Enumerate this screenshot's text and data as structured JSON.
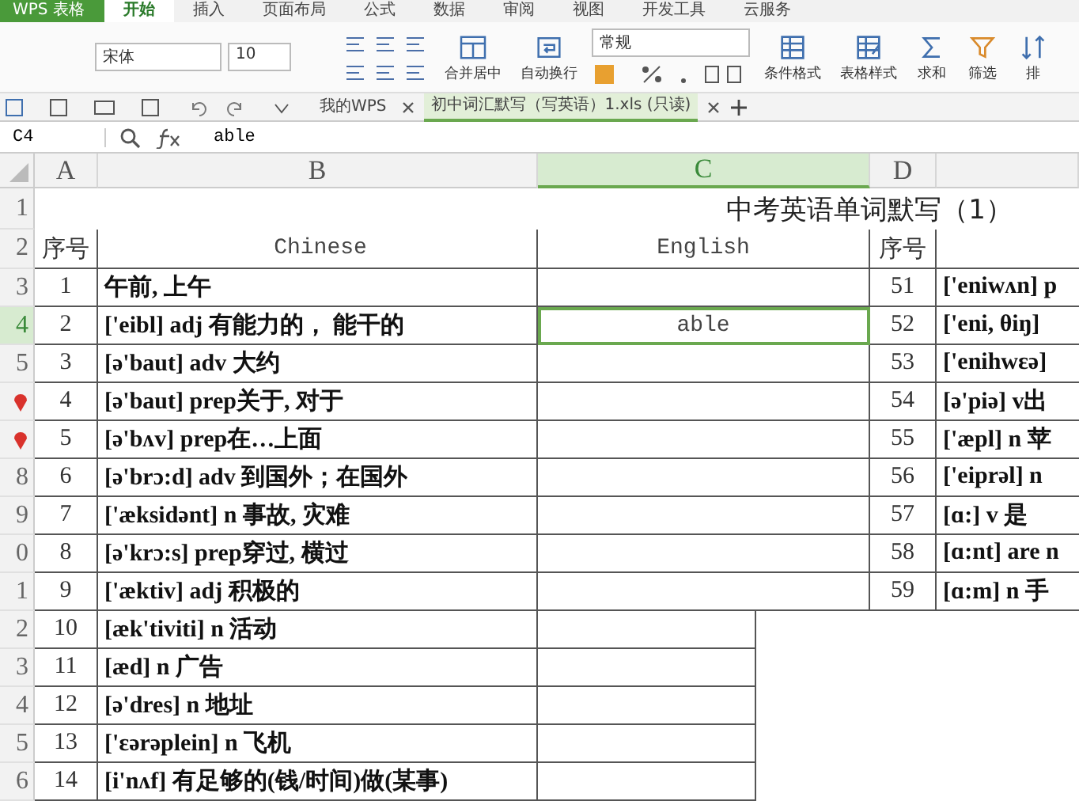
{
  "app": {
    "label": "WPS 表格"
  },
  "menu_tabs": [
    {
      "label": "开始",
      "selected": true
    },
    {
      "label": "插入",
      "selected": false
    },
    {
      "label": "页面布局",
      "selected": false
    },
    {
      "label": "公式",
      "selected": false
    },
    {
      "label": "数据",
      "selected": false
    },
    {
      "label": "审阅",
      "selected": false
    },
    {
      "label": "视图",
      "selected": false
    },
    {
      "label": "开发工具",
      "selected": false
    },
    {
      "label": "云服务",
      "selected": false
    }
  ],
  "ribbon": {
    "font": "宋体",
    "font_size": "10",
    "number_format": "常规",
    "buttons": [
      {
        "kind": "merge",
        "label": "合并居中"
      },
      {
        "kind": "wrap",
        "label": "自动换行"
      }
    ],
    "right_buttons": [
      {
        "kind": "conditional",
        "label": "条件格式"
      },
      {
        "kind": "table",
        "label": "表格样式"
      },
      {
        "kind": "sum",
        "label": "求和"
      },
      {
        "kind": "filter",
        "label": "筛选"
      },
      {
        "kind": "sort",
        "label": "排"
      }
    ]
  },
  "doc_tabs": [
    {
      "label": "我的WPS",
      "selected": false
    },
    {
      "label": "初中词汇默写（写英语）1.xls (只读)",
      "selected": true
    }
  ],
  "formula_bar": {
    "name_box": "C4",
    "formula": "able"
  },
  "columns": [
    {
      "label": "A",
      "selected": false
    },
    {
      "label": "B",
      "selected": false
    },
    {
      "label": "C",
      "selected": true
    },
    {
      "label": "D",
      "selected": false
    }
  ],
  "rows": [
    {
      "header": "1",
      "marker": false,
      "selected": false,
      "kind": "title",
      "title": "中考英语单词默写（1）"
    },
    {
      "header": "2",
      "marker": false,
      "selected": false,
      "kind": "heading",
      "no": "序号",
      "chinese": "Chinese",
      "english": "English",
      "no2": "序号"
    },
    {
      "header": "3",
      "marker": false,
      "selected": false,
      "kind": "entry",
      "no": "1",
      "chinese": "午前, 上午",
      "no2": "51",
      "chinese2": "['eniwʌn] p"
    },
    {
      "header": "4",
      "marker": false,
      "selected": true,
      "kind": "entry",
      "no": "2",
      "chinese": "['eibl] adj 有能力的， 能干的",
      "english": "able",
      "no2": "52",
      "chinese2": "['eni, θiŋ]"
    },
    {
      "header": "5",
      "marker": false,
      "selected": false,
      "kind": "entry",
      "no": "3",
      "chinese": "[ə'baut] adv 大约",
      "no2": "53",
      "chinese2": "['enihwɛə]"
    },
    {
      "marker": true,
      "selected": false,
      "kind": "entry",
      "no": "4",
      "chinese": "[ə'baut] prep关于, 对于",
      "no2": "54",
      "chinese2": "[ə'piə] v出"
    },
    {
      "marker": true,
      "selected": false,
      "kind": "entry",
      "no": "5",
      "chinese": "[ə'bʌv] prep在…上面",
      "no2": "55",
      "chinese2": "['æpl] n 苹"
    },
    {
      "header": "8",
      "marker": false,
      "selected": false,
      "kind": "entry",
      "no": "6",
      "chinese": "[ə'brɔ:d] adv 到国外；在国外",
      "no2": "56",
      "chinese2": "['eiprəl] n"
    },
    {
      "header": "9",
      "marker": false,
      "selected": false,
      "kind": "entry",
      "no": "7",
      "chinese": "['æksidənt] n 事故, 灾难",
      "no2": "57",
      "chinese2": "[ɑ:] v 是"
    },
    {
      "header": "0",
      "marker": false,
      "selected": false,
      "kind": "entry",
      "no": "8",
      "chinese": "[ə'krɔ:s] prep穿过, 横过",
      "no2": "58",
      "chinese2": "[ɑ:nt] are n"
    },
    {
      "header": "1",
      "marker": false,
      "selected": false,
      "kind": "entry",
      "no": "9",
      "chinese": "['æktiv] adj 积极的",
      "no2": "59",
      "chinese2": "[ɑ:m] n 手"
    },
    {
      "header": "2",
      "marker": false,
      "selected": false,
      "kind": "entry",
      "no": "10",
      "chinese": "[æk'tiviti] n 活动"
    },
    {
      "header": "3",
      "marker": false,
      "selected": false,
      "kind": "entry",
      "no": "11",
      "chinese": "[æd] n 广告"
    },
    {
      "header": "4",
      "marker": false,
      "selected": false,
      "kind": "entry",
      "no": "12",
      "chinese": "[ə'dres] n 地址"
    },
    {
      "header": "5",
      "marker": false,
      "selected": false,
      "kind": "entry",
      "no": "13",
      "chinese": "['ɛərəplein] n 飞机"
    },
    {
      "header": "6",
      "marker": false,
      "selected": false,
      "kind": "entry",
      "no": "14",
      "chinese": "[i'nʌf] 有足够的(钱/时间)做(某事)"
    }
  ]
}
